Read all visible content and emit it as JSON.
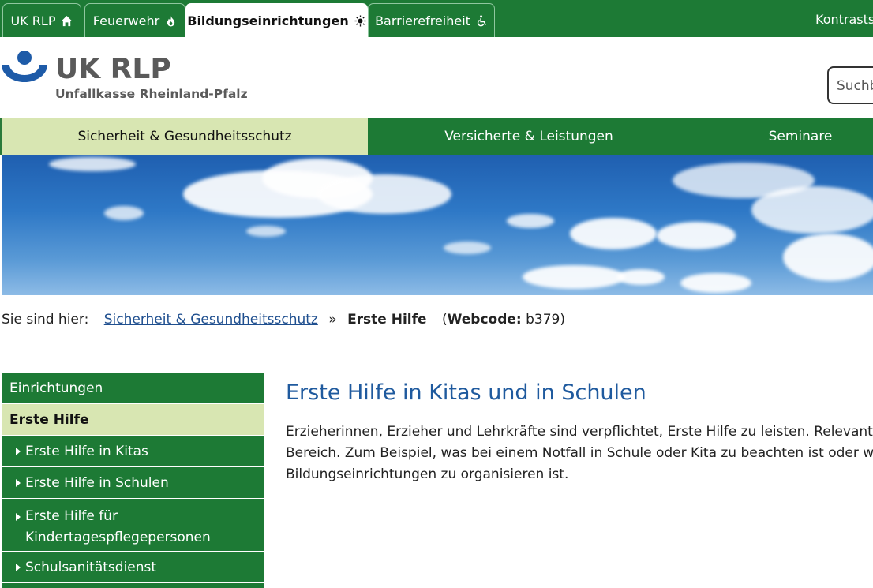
{
  "topTabs": [
    {
      "label": "UK RLP",
      "icon": "home-icon"
    },
    {
      "label": "Feuerwehr",
      "icon": "flame-icon"
    },
    {
      "label": "Bildungseinrichtungen",
      "icon": "sun-icon"
    },
    {
      "label": "Barrierefreiheit",
      "icon": "wheelchair-icon"
    }
  ],
  "kontrast": "Kontrastst",
  "logo": {
    "title": "UK RLP",
    "subtitle": "Unfallkasse Rheinland-Pfalz"
  },
  "search": {
    "placeholder": "Suchb"
  },
  "mainNav": [
    "Sicherheit & Gesundheitsschutz",
    "Versicherte & Leistungen",
    "Seminare"
  ],
  "breadcrumb": {
    "prefix": "Sie sind hier:",
    "link": "Sicherheit & Gesundheitsschutz",
    "sep": "»",
    "current": "Erste Hilfe",
    "webcodeOpen": "(",
    "webcodeLabel": "Webcode:",
    "webcodeValue": "b379)"
  },
  "sidebar": {
    "top": "Einrichtungen",
    "active": "Erste Hilfe",
    "items": [
      "Erste Hilfe in Kitas",
      "Erste Hilfe in Schulen",
      "Erste Hilfe für\nKindertagespflegepersonen",
      "Schulsanitätsdienst"
    ]
  },
  "content": {
    "title": "Erste Hilfe in Kitas und in Schulen",
    "lines": [
      "Erzieherinnen, Erzieher und Lehrkräfte sind verpflichtet, Erste Hilfe zu leisten. Relevante I",
      "Bereich. Zum Beispiel, was bei einem Notfall in Schule oder Kita zu beachten ist oder wie",
      "Bildungseinrichtungen zu organisieren ist."
    ]
  },
  "colors": {
    "green": "#1d7a35",
    "lightGreen": "#d8e6b2",
    "headingBlue": "#1f5a9e",
    "logoBlue": "#1e5ba8"
  }
}
